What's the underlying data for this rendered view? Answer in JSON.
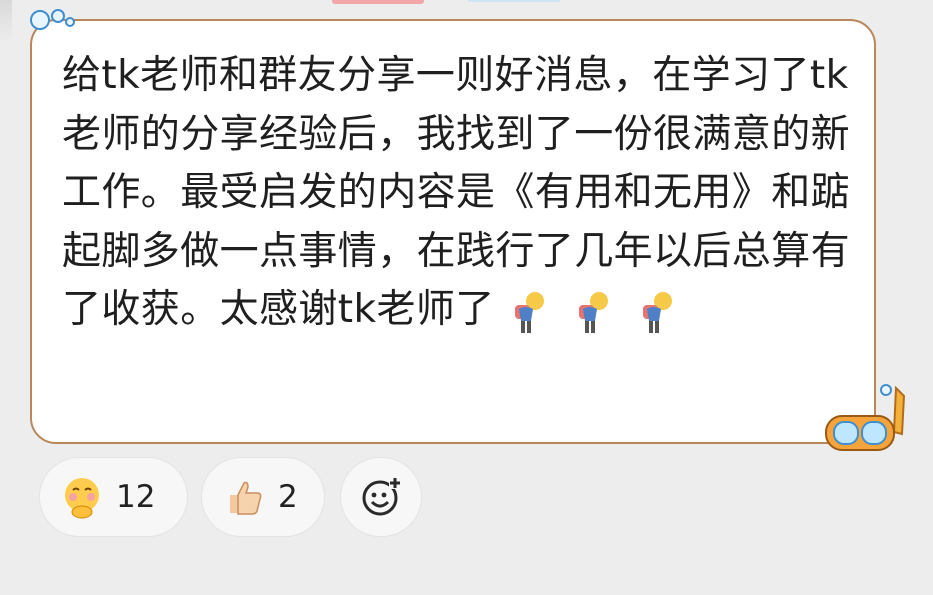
{
  "message": {
    "text": "给tk老师和群友分享一则好消息，在学习了tk老师的分享经验后，我找到了一份很满意的新工作。最受启发的内容是《有用和无用》和踮起脚多做一点事情，在践行了几年以后总算有了收获。太感谢tk老师了",
    "trailing_emojis": [
      "bowing-person-emoji",
      "bowing-person-emoji",
      "bowing-person-emoji"
    ],
    "bubble_border_color": "#b9875a"
  },
  "reactions": [
    {
      "icon": "hugging-face-emoji",
      "count": "12"
    },
    {
      "icon": "thumbs-up-emoji",
      "count": "2"
    }
  ],
  "add_reaction": {
    "icon": "add-emoji-icon"
  }
}
